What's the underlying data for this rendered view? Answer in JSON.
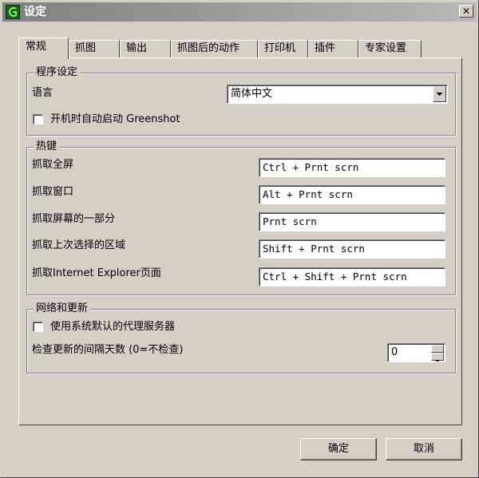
{
  "window": {
    "title": "设定"
  },
  "tabs": [
    "常规",
    "抓图",
    "输出",
    "抓图后的动作",
    "打印机",
    "插件",
    "专家设置"
  ],
  "program_settings": {
    "title": "程序设定",
    "language_label": "语言",
    "language_value": "简体中文",
    "autostart_label": "开机时自动启动 Greenshot",
    "autostart_checked": false
  },
  "hotkeys": {
    "title": "热键",
    "items": [
      {
        "label": "抓取全屏",
        "value": "Ctrl + Prnt scrn"
      },
      {
        "label": "抓取窗口",
        "value": "Alt + Prnt scrn"
      },
      {
        "label": "抓取屏幕的一部分",
        "value": "Prnt scrn"
      },
      {
        "label": "抓取上次选择的区域",
        "value": "Shift + Prnt scrn"
      },
      {
        "label": "抓取Internet Explorer页面",
        "value": "Ctrl + Shift + Prnt scrn"
      }
    ]
  },
  "network": {
    "title": "网络和更新",
    "proxy_label": "使用系统默认的代理服务器",
    "proxy_checked": false,
    "update_label": "检查更新的间隔天数 (0=不检查)",
    "update_value": "0"
  },
  "buttons": {
    "ok": "确定",
    "cancel": "取消"
  },
  "icons": {
    "app": "greenshot-app-icon",
    "close": "close-icon",
    "dropdown": "chevron-down-icon",
    "spin_up": "spin-up-icon",
    "spin_down": "spin-down-icon"
  }
}
